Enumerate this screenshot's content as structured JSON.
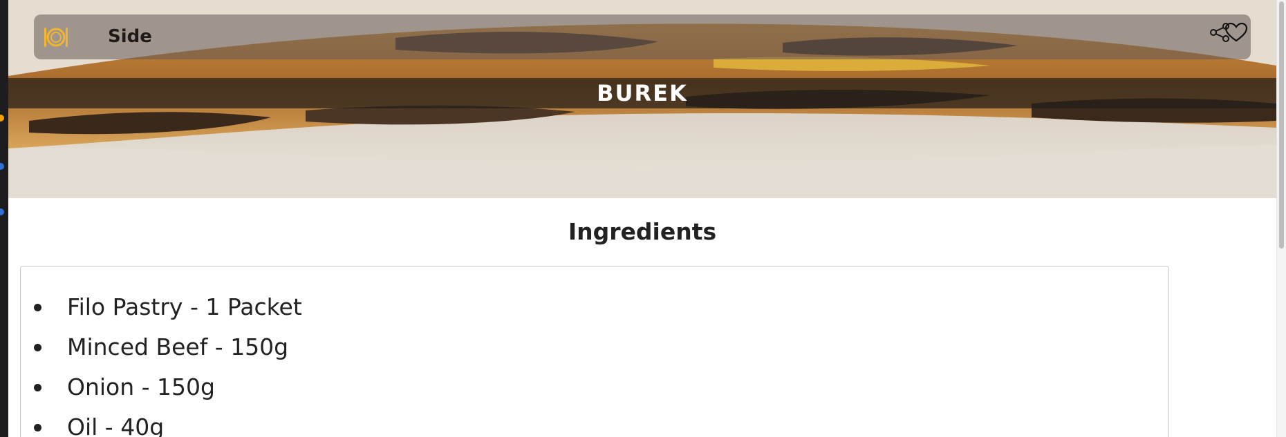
{
  "recipe": {
    "category": "Side",
    "title": "BUREK"
  },
  "icons": {
    "category": "plate-cutlery-icon",
    "share": "share-icon",
    "favorite": "heart-icon"
  },
  "ingredients": {
    "heading": "Ingredients",
    "items": [
      "Filo Pastry - 1 Packet",
      "Minced Beef - 150g",
      "Onion - 150g",
      "Oil - 40g"
    ]
  },
  "colors": {
    "accent": "#f2b632",
    "title_text": "#ffffff",
    "body_text": "#222222"
  }
}
